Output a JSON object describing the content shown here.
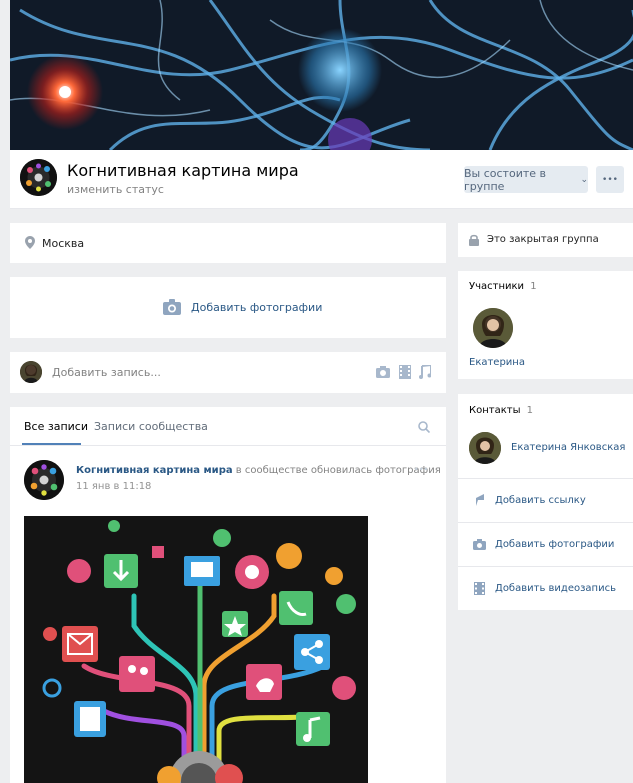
{
  "group": {
    "title": "Когнитивная картина мира",
    "status_placeholder": "изменить статус",
    "member_button": "Вы состоите в группе",
    "more_button": "•••"
  },
  "info": {
    "location": "Москва"
  },
  "photos": {
    "add_label": "Добавить фотографии"
  },
  "composer": {
    "placeholder": "Добавить запись..."
  },
  "wall": {
    "tabs": [
      {
        "label": "Все записи"
      },
      {
        "label": "Записи сообщества"
      }
    ],
    "post": {
      "author": "Когнитивная картина мира",
      "action": "в сообществе обновилась фотография",
      "time": "11 янв в 11:18",
      "more": "•••"
    }
  },
  "sidebar": {
    "closed_group": "Это закрытая группа",
    "members": {
      "title": "Участники",
      "count": "1",
      "items": [
        {
          "name": "Екатерина"
        }
      ]
    },
    "contacts": {
      "title": "Контакты",
      "count": "1",
      "items": [
        {
          "name": "Екатерина Янковская"
        }
      ]
    },
    "actions": [
      {
        "label": "Добавить ссылку",
        "icon": "link-icon"
      },
      {
        "label": "Добавить фотографии",
        "icon": "camera-icon"
      },
      {
        "label": "Добавить видеозапись",
        "icon": "video-icon"
      }
    ]
  },
  "colors": {
    "link": "#2a5885",
    "muted": "#828282",
    "button_bg": "#e5ebf1",
    "icon": "#a8b8cc"
  }
}
